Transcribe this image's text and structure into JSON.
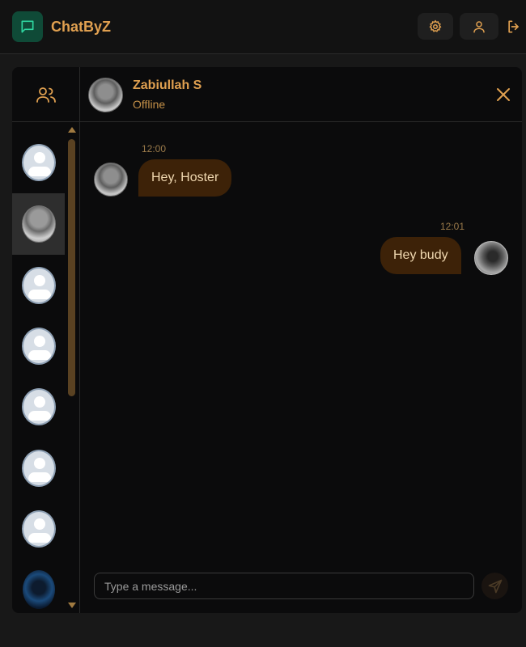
{
  "app": {
    "name": "ChatByZ",
    "accent": "#e0a050",
    "logo_bg": "#0f4a37"
  },
  "header": {
    "buttons": [
      {
        "icon": "gear-icon"
      },
      {
        "icon": "user-icon"
      },
      {
        "icon": "logout-icon"
      }
    ]
  },
  "sidebar": {
    "header_icon": "users-icon",
    "contacts": [
      {
        "avatar": "default"
      },
      {
        "avatar": "photo",
        "active": true
      },
      {
        "avatar": "default"
      },
      {
        "avatar": "default"
      },
      {
        "avatar": "default"
      },
      {
        "avatar": "default"
      },
      {
        "avatar": "default"
      },
      {
        "avatar": "hacker"
      }
    ]
  },
  "chat": {
    "contact_name": "Zabiullah S",
    "status": "Offline",
    "messages": [
      {
        "direction": "in",
        "time": "12:00",
        "text": "Hey, Hoster"
      },
      {
        "direction": "out",
        "time": "12:01",
        "text": "Hey budy"
      }
    ],
    "composer": {
      "placeholder": "Type a message...",
      "value": ""
    }
  }
}
